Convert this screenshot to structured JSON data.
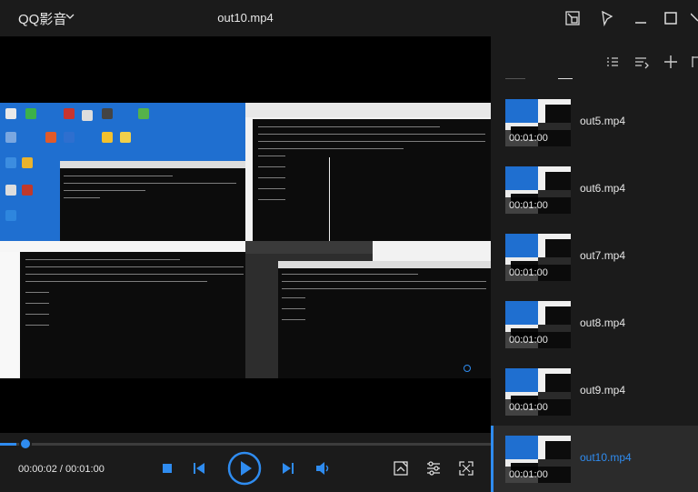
{
  "app": {
    "brand": "QQ影音",
    "title": "out10.mp4"
  },
  "player": {
    "time_current": "00:00:02",
    "time_separator": " / ",
    "time_total": "00:01:00",
    "progress": 0.033
  },
  "icons": {
    "mini_mode": "picture-in-picture-icon",
    "pin": "pin-icon",
    "minimize": "minimize-icon",
    "maximize": "maximize-icon",
    "close": "close-icon",
    "stop": "stop-icon",
    "prev": "previous-icon",
    "play": "play-icon",
    "next": "next-icon",
    "volume": "volume-icon",
    "screenshot": "screenshot-icon",
    "settings": "equalizer-icon",
    "fullscreen": "fullscreen-icon",
    "list_view": "list-view-icon",
    "play_order": "play-order-icon",
    "add": "add-icon"
  },
  "playlist": [
    {
      "name": "out5.mp4",
      "duration": "00:01:00",
      "active": false
    },
    {
      "name": "out6.mp4",
      "duration": "00:01:00",
      "active": false
    },
    {
      "name": "out7.mp4",
      "duration": "00:01:00",
      "active": false
    },
    {
      "name": "out8.mp4",
      "duration": "00:01:00",
      "active": false
    },
    {
      "name": "out9.mp4",
      "duration": "00:01:00",
      "active": false
    },
    {
      "name": "out10.mp4",
      "duration": "00:01:00",
      "active": true
    }
  ],
  "colors": {
    "accent": "#2f8cf0",
    "panel": "#1b1b1b",
    "text": "#e6e6e6"
  }
}
